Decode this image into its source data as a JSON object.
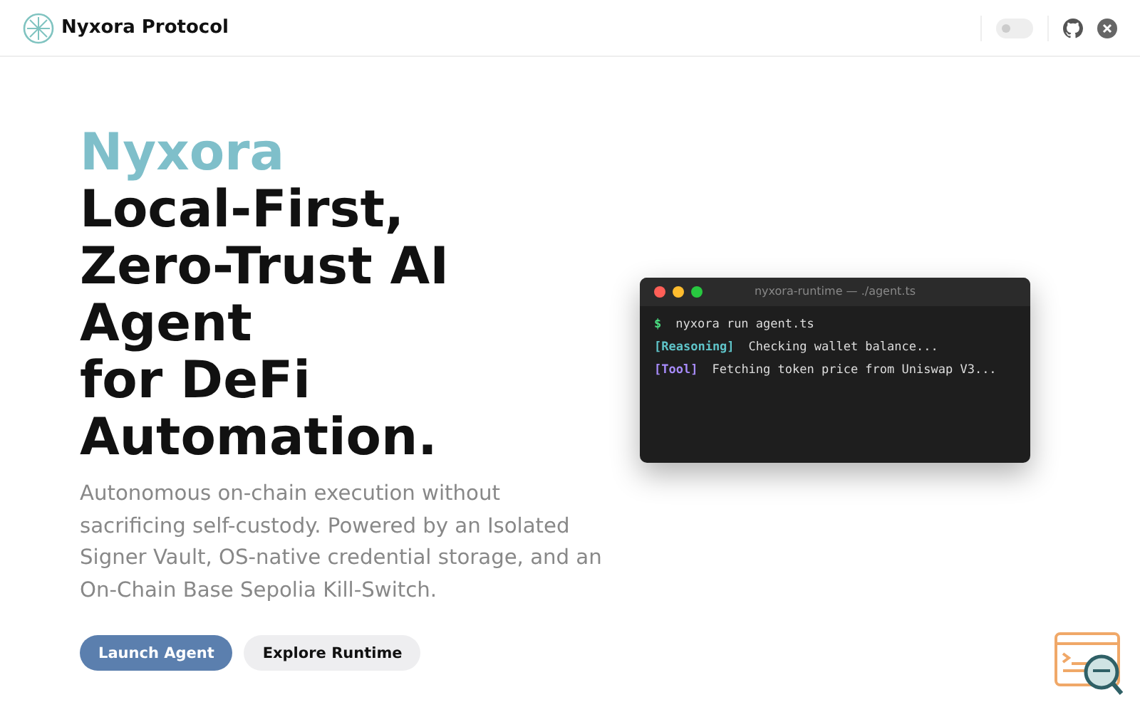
{
  "header": {
    "brand": "Nyxora Protocol",
    "theme_toggle": {
      "on": false
    }
  },
  "hero": {
    "accent": "Nyxora",
    "title_lines": [
      "Local-First,",
      "Zero-Trust AI",
      "Agent",
      "for DeFi",
      "Automation."
    ],
    "subtitle": "Autonomous on-chain execution without sacrificing self-custody. Powered by an Isolated Signer Vault, OS-native credential storage, and an On-Chain Base Sepolia Kill-Switch.",
    "buttons": [
      {
        "label": "Launch Agent",
        "kind": "primary"
      },
      {
        "label": "Explore Runtime",
        "kind": "secondary"
      }
    ]
  },
  "terminal": {
    "title": "nyxora-runtime — ./agent.ts",
    "lines": [
      {
        "kind": "prompt",
        "tag": "$",
        "text": "nyxora run agent.ts"
      },
      {
        "kind": "reasoning",
        "tag": "[Reasoning]",
        "text": "Checking wallet balance..."
      },
      {
        "kind": "tool",
        "tag": "[Tool]",
        "text": "Fetching token price from Uniswap V3..."
      }
    ]
  }
}
